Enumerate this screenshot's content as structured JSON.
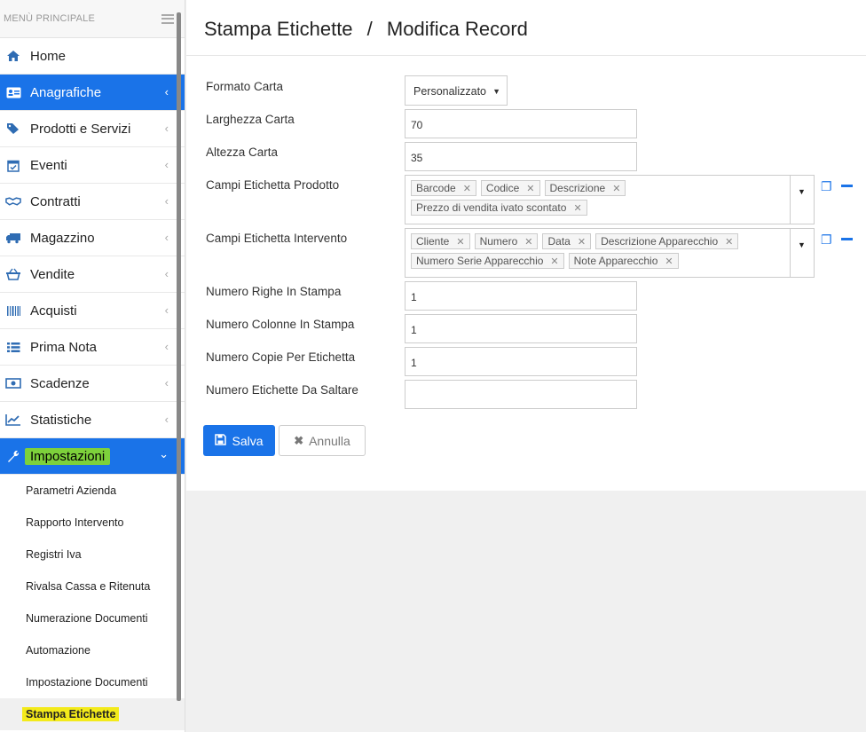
{
  "sidebar": {
    "header": "MENÙ PRINCIPALE",
    "items": [
      {
        "label": "Home",
        "icon": "home-icon"
      },
      {
        "label": "Anagrafiche",
        "icon": "id-card-icon"
      },
      {
        "label": "Prodotti e Servizi",
        "icon": "tags-icon"
      },
      {
        "label": "Eventi",
        "icon": "calendar-check-icon"
      },
      {
        "label": "Contratti",
        "icon": "handshake-icon"
      },
      {
        "label": "Magazzino",
        "icon": "truck-icon"
      },
      {
        "label": "Vendite",
        "icon": "basket-icon"
      },
      {
        "label": "Acquisti",
        "icon": "barcode-icon"
      },
      {
        "label": "Prima Nota",
        "icon": "list-icon"
      },
      {
        "label": "Scadenze",
        "icon": "money-bill-icon"
      },
      {
        "label": "Statistiche",
        "icon": "line-chart-icon"
      },
      {
        "label": "Impostazioni",
        "icon": "wrench-icon"
      }
    ],
    "subitems": [
      "Parametri Azienda",
      "Rapporto Intervento",
      "Registri Iva",
      "Rivalsa Cassa e Ritenuta",
      "Numerazione Documenti",
      "Automazione",
      "Impostazione Documenti",
      "Stampa Etichette"
    ]
  },
  "page": {
    "breadcrumb_section": "Stampa Etichette",
    "breadcrumb_sep": "/",
    "breadcrumb_page": "Modifica Record"
  },
  "form": {
    "formato_carta": {
      "label": "Formato Carta",
      "value": "Personalizzato"
    },
    "larghezza_carta": {
      "label": "Larghezza Carta",
      "value": "70"
    },
    "altezza_carta": {
      "label": "Altezza Carta",
      "value": "35"
    },
    "campi_prodotto": {
      "label": "Campi Etichetta Prodotto",
      "tags": [
        "Barcode",
        "Codice",
        "Descrizione",
        "Prezzo di vendita ivato scontato"
      ]
    },
    "campi_intervento": {
      "label": "Campi Etichetta Intervento",
      "tags": [
        "Cliente",
        "Numero",
        "Data",
        "Descrizione Apparecchio",
        "Numero Serie Apparecchio",
        "Note Apparecchio"
      ]
    },
    "righe": {
      "label": "Numero Righe In Stampa",
      "value": "1"
    },
    "colonne": {
      "label": "Numero Colonne In Stampa",
      "value": "1"
    },
    "copie": {
      "label": "Numero Copie Per Etichetta",
      "value": "1"
    },
    "saltare": {
      "label": "Numero Etichette Da Saltare",
      "value": ""
    }
  },
  "buttons": {
    "save": "Salva",
    "cancel": "Annulla"
  },
  "colors": {
    "accent": "#1a73e8",
    "highlight_green": "#7dd13b",
    "highlight_yellow": "#f3ea1a"
  }
}
